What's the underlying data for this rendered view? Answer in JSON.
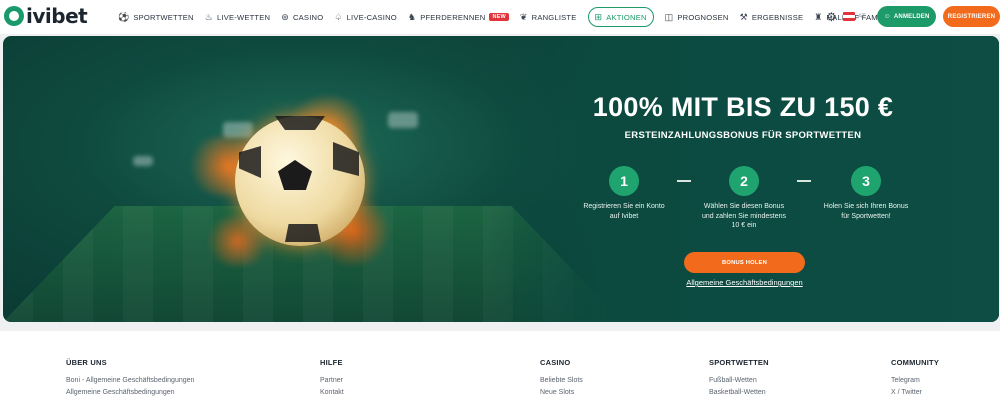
{
  "header": {
    "logo_text": "ivibet",
    "nav": [
      {
        "label": "SPORTWETTEN",
        "icon": "soccer-ball-icon"
      },
      {
        "label": "LIVE-WETTEN",
        "icon": "fire-icon"
      },
      {
        "label": "CASINO",
        "icon": "roulette-icon"
      },
      {
        "label": "LIVE-CASINO",
        "icon": "cards-icon"
      },
      {
        "label": "PFERDERENNEN",
        "icon": "horse-icon",
        "badge": "NEW"
      },
      {
        "label": "RANGLISTE",
        "icon": "laurel-icon"
      },
      {
        "label": "AKTIONEN",
        "icon": "gift-icon",
        "active": true
      },
      {
        "label": "PROGNOSEN",
        "icon": "chart-icon"
      },
      {
        "label": "ERGEBNISSE",
        "icon": "tools-icon"
      },
      {
        "label": "HALL OF FAME",
        "icon": "castle-icon"
      }
    ],
    "language": "AT",
    "login_label": "ANMELDEN",
    "register_label": "REGISTRIEREN"
  },
  "hero": {
    "title": "100% MIT BIS ZU 150 €",
    "subtitle": "ERSTEINZAHLUNGSBONUS FÜR SPORTWETTEN",
    "steps": [
      {
        "number": "1",
        "text": "Registrieren Sie ein Konto auf Ivibet"
      },
      {
        "number": "2",
        "text": "Wählen Sie diesen Bonus und zahlen Sie mindestens 10 € ein"
      },
      {
        "number": "3",
        "text": "Holen Sie sich Ihren Bonus für Sportwetten!"
      }
    ],
    "cta_label": "BONUS HOLEN",
    "terms_label": "Allgemeine Geschäftsbedingungen"
  },
  "footer": {
    "columns": [
      {
        "heading": "ÜBER UNS",
        "links": [
          "Boni - Allgemeine Geschäftsbedingungen",
          "Allgemeine Geschäftsbedingungen"
        ]
      },
      {
        "heading": "HILFE",
        "links": [
          "Partner",
          "Kontakt"
        ]
      },
      {
        "heading": "CASINO",
        "links": [
          "Beliebte Slots",
          "Neue Slots"
        ]
      },
      {
        "heading": "SPORTWETTEN",
        "links": [
          "Fußball-Wetten",
          "Basketball-Wetten"
        ]
      },
      {
        "heading": "COMMUNITY",
        "links": [
          "Telegram",
          "X / Twitter"
        ]
      }
    ]
  },
  "colors": {
    "brand_green": "#1c9a68",
    "accent_orange": "#f26a1b",
    "hero_bg": "#0d4d43"
  }
}
